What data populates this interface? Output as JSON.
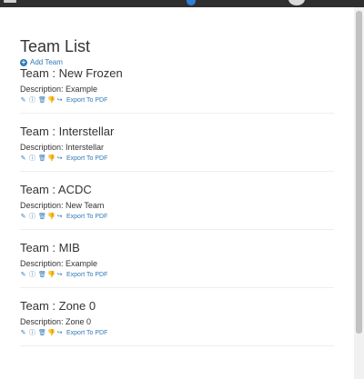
{
  "page": {
    "title": "Team List",
    "add_team_label": "Add Team"
  },
  "teams": [
    {
      "name": "Team : New Frozen",
      "description": "Description: Example",
      "export_label": "Export To PDF"
    },
    {
      "name": "Team : Interstellar",
      "description": "Description: Interstellar",
      "export_label": "Export To PDF"
    },
    {
      "name": "Team : ACDC",
      "description": "Description: New Team",
      "export_label": "Export To PDF"
    },
    {
      "name": "Team : MIB",
      "description": "Description: Example",
      "export_label": "Export To PDF"
    },
    {
      "name": "Team : Zone 0",
      "description": "Description: Zone 0",
      "export_label": "Export To PDF"
    }
  ],
  "icons": {
    "menu": "hamburger-icon",
    "center": "app-icon",
    "avatar": "user-avatar-icon",
    "edit": "pencil-icon",
    "info": "info-icon",
    "delete": "trash-icon",
    "unlike": "thumbs-down-icon",
    "share": "share-icon"
  },
  "colors": {
    "link": "#337ab7",
    "text": "#333333",
    "topbar": "#2f2f2f"
  }
}
